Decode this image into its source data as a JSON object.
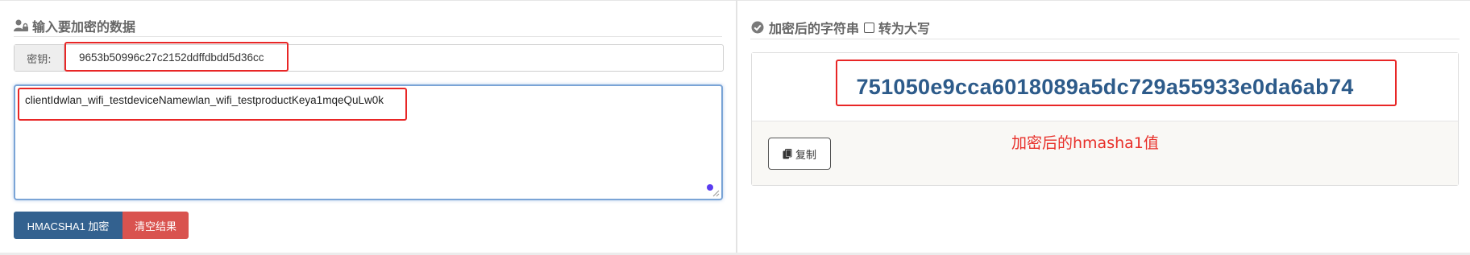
{
  "left": {
    "heading": "输入要加密的数据",
    "key_label": "密钥:",
    "key_value": "9653b50996c27c2152ddffdbdd5d36cc",
    "input_text": "clientIdwlan_wifi_testdeviceNamewlan_wifi_testproductKeya1mqeQuLw0k",
    "encrypt_button": "HMACSHA1 加密",
    "clear_button": "清空结果"
  },
  "right": {
    "heading": "加密后的字符串",
    "uppercase_label": "转为大写",
    "result_hash": "751050e9cca6018089a5dc729a55933e0da6ab74",
    "copy_button": "复制",
    "annotation": "加密后的hmasha1值"
  },
  "colors": {
    "primary": "#33618f",
    "danger": "#d9534f",
    "highlight": "#e82626",
    "hash": "#2d5b8a"
  },
  "icons": {
    "left_heading": "user-lock-icon",
    "right_heading": "check-circle-icon",
    "copy": "copy-icon"
  }
}
